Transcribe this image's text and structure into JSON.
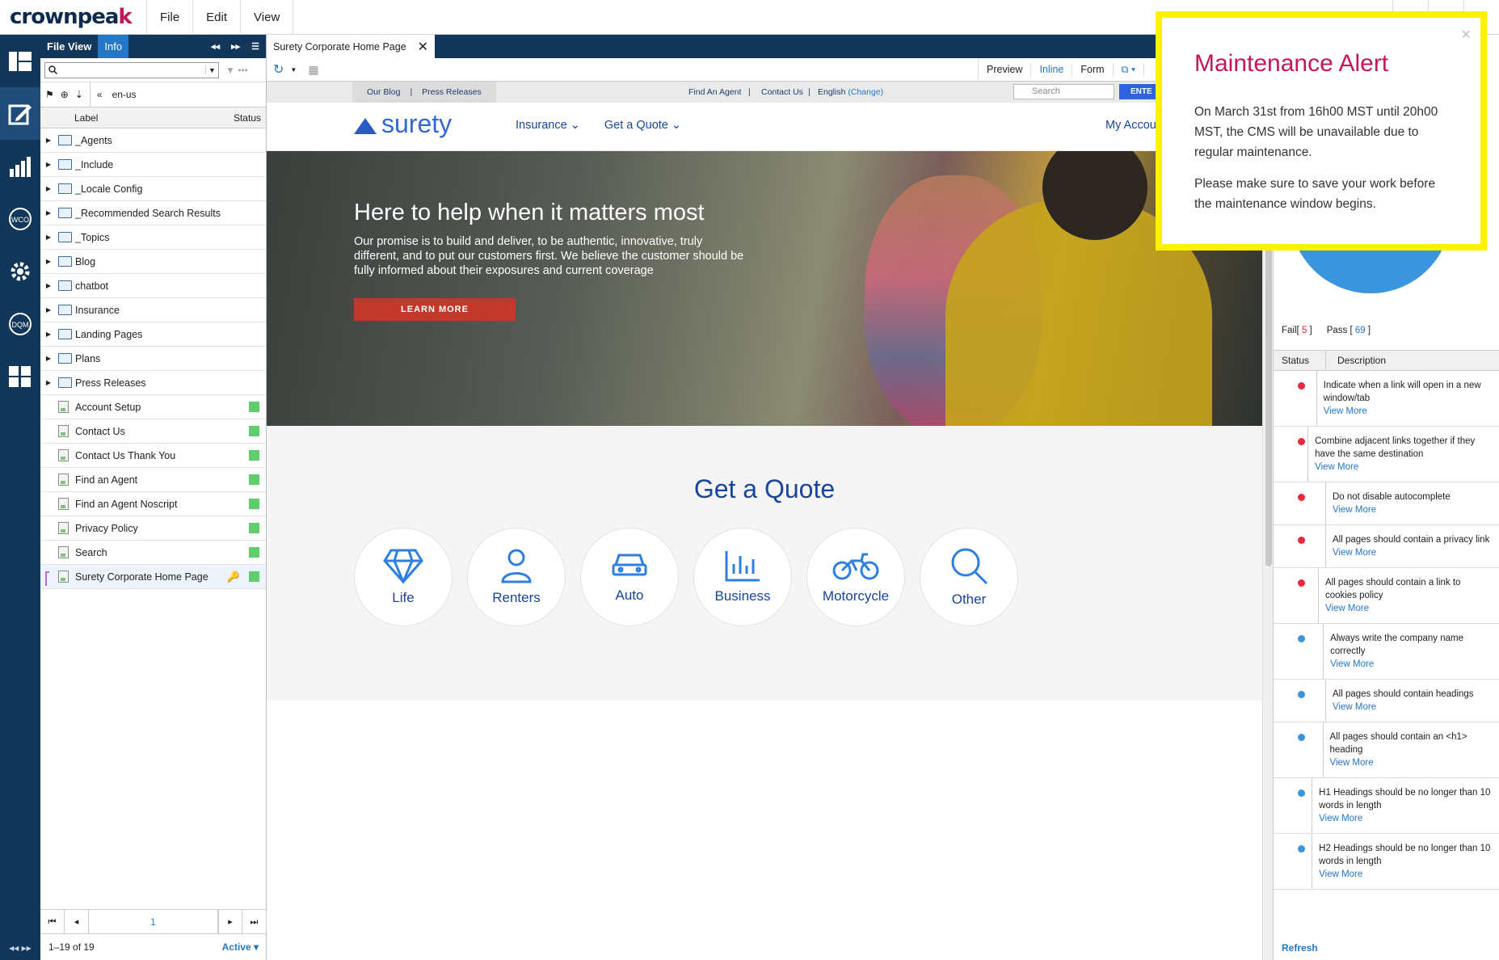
{
  "app": {
    "logo": "crownpeak",
    "menu": [
      "File",
      "Edit",
      "View"
    ]
  },
  "tree": {
    "tabs": {
      "file_view": "File View",
      "info": "Info"
    },
    "locale": "en-us",
    "columns": {
      "label": "Label",
      "status": "Status"
    },
    "folders": [
      "_Agents",
      "_Include",
      "_Locale Config",
      "_Recommended Search Results",
      "_Topics",
      "Blog",
      "chatbot",
      "Insurance",
      "Landing Pages",
      "Plans",
      "Press Releases"
    ],
    "pages": [
      "Account Setup",
      "Contact Us",
      "Contact Us Thank You",
      "Find an Agent",
      "Find an Agent Noscript",
      "Privacy Policy",
      "Search",
      "Surety Corporate Home Page"
    ],
    "page_number": "1",
    "range": "1–19 of 19",
    "filter": "Active"
  },
  "editor": {
    "tab_title": "Surety Corporate Home Page",
    "modes": [
      "Preview",
      "Inline",
      "Form"
    ]
  },
  "site": {
    "util_links": [
      "Our Blog",
      "Press Releases"
    ],
    "find_agent": "Find An Agent",
    "contact": "Contact Us",
    "language": "English",
    "change": "(Change)",
    "search_placeholder": "Search",
    "enter": "ENTE",
    "brand": "surety",
    "nav": [
      "Insurance",
      "Get a Quote"
    ],
    "account": "My Accou",
    "hero_title": "Here to help when it matters most",
    "hero_text": "Our promise is to build and deliver, to be authentic, innovative, truly different, and to put our customers first. We believe the customer should be fully informed about their exposures and current coverage",
    "hero_button": "LEARN MORE",
    "quote_title": "Get a Quote",
    "quote_items": [
      "Life",
      "Renters",
      "Auto",
      "Business",
      "Motorcycle",
      "Other"
    ]
  },
  "dqm": {
    "fail_label": "Fail[",
    "fail_count": "5",
    "pass_label": "Pass [",
    "pass_count": "69",
    "col_status": "Status",
    "col_desc": "Description",
    "view_more": "View More",
    "checks": [
      {
        "text": "Indicate when a link will open in a new window/tab",
        "status": "fail"
      },
      {
        "text": "Combine adjacent links together if they have the same destination",
        "status": "fail"
      },
      {
        "text": "Do not disable autocomplete",
        "status": "fail"
      },
      {
        "text": "All pages should contain a privacy link",
        "status": "fail"
      },
      {
        "text": "All pages should contain a link to cookies policy",
        "status": "fail"
      },
      {
        "text": "Always write the company name correctly",
        "status": "info"
      },
      {
        "text": "All pages should contain headings",
        "status": "info"
      },
      {
        "text": "All pages should contain an <h1> heading",
        "status": "info"
      },
      {
        "text": "H1 Headings should be no longer than 10 words in length",
        "status": "info"
      },
      {
        "text": "H2 Headings should be no longer than 10 words in length",
        "status": "info"
      }
    ],
    "refresh": "Refresh",
    "colors": {
      "fail": "#e8283c",
      "info": "#3a95dd"
    }
  },
  "alert": {
    "title": "Maintenance Alert",
    "p1": "On March 31st from 16h00 MST until 20h00 MST, the CMS will be unavailable due to regular maintenance.",
    "p2": "Please make sure to save your work before the maintenance window begins.",
    "close": "×"
  }
}
